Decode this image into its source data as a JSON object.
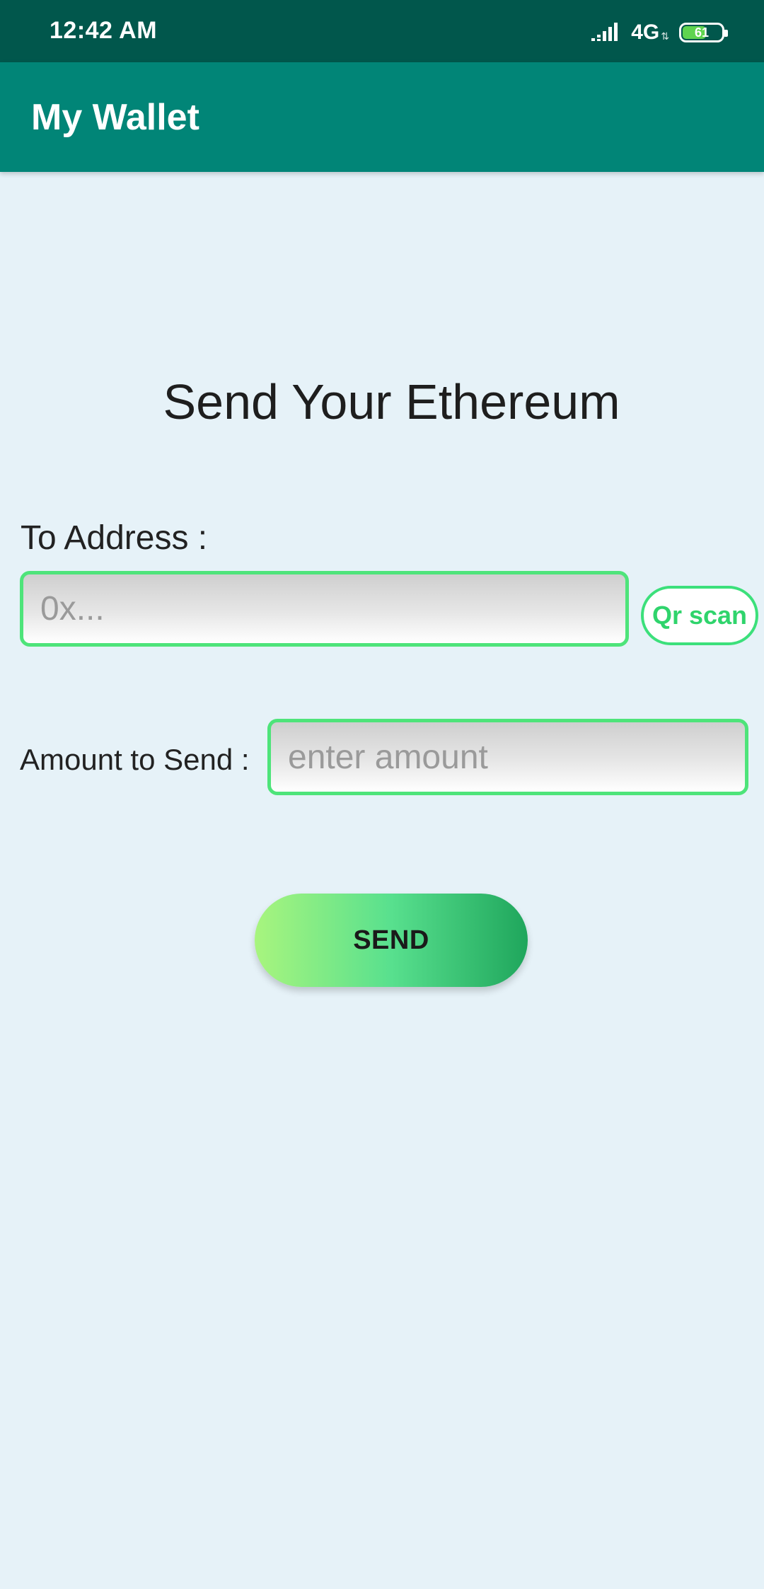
{
  "status_bar": {
    "time": "12:42 AM",
    "network": "4G",
    "battery_level": "61",
    "icons": [
      "signal-icon",
      "battery-icon"
    ]
  },
  "app_bar": {
    "title": "My Wallet"
  },
  "send_form": {
    "heading": "Send Your Ethereum",
    "to_address_label": "To Address :",
    "to_address_placeholder": "0x...",
    "to_address_value": "",
    "qr_scan_label": "Qr scan",
    "amount_label": "Amount to Send :",
    "amount_placeholder": "enter amount",
    "amount_value": "",
    "send_label": "SEND"
  },
  "colors": {
    "status_bar": "#01574c",
    "app_bar": "#018577",
    "background": "#e6f2f8",
    "input_border": "#4ee47a",
    "qr_accent": "#2fd46c",
    "send_gradient_start": "#a8f57e",
    "send_gradient_end": "#1fa65c"
  }
}
